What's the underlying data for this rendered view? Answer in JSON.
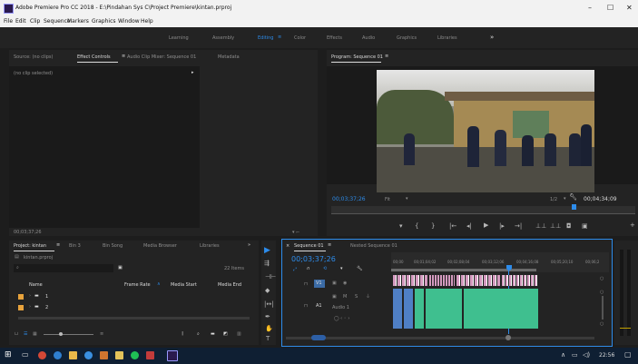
{
  "window": {
    "title": "Adobe Premiere Pro CC 2018 - E:\\Pindahan Sys C\\Project Premiere\\kintan.prproj",
    "controls": [
      "–",
      "☐",
      "✕"
    ]
  },
  "menu": [
    "File",
    "Edit",
    "Clip",
    "Sequence",
    "Markers",
    "Graphics",
    "Window",
    "Help"
  ],
  "workspaces": {
    "items": [
      "Learning",
      "Assembly",
      "Editing",
      "Color",
      "Effects",
      "Audio",
      "Graphics",
      "Libraries"
    ],
    "active": "Editing",
    "more": "»"
  },
  "source_panel": {
    "tabs": [
      "Source: (no clips)",
      "Effect Controls",
      "Audio Clip Mixer: Sequence 01",
      "Metadata"
    ],
    "active_tab": "Effect Controls",
    "no_clip": "(no clip selected)",
    "timecode": "00;03;37;26"
  },
  "program_monitor": {
    "tab": "Program: Sequence 01",
    "timecode_left": "00;03;37;26",
    "fit": "Fit",
    "quality": "1/2",
    "timecode_right": "00;04;34;09"
  },
  "project_panel": {
    "tabs": [
      "Project: kintan",
      "Bin 3",
      "Bin Song",
      "Media Browser",
      "Libraries"
    ],
    "active_tab": "Project: kintan",
    "project_name": "kintan.prproj",
    "item_count": "22 Items",
    "columns": [
      "Name",
      "Frame Rate",
      "Media Start",
      "Media End"
    ],
    "rows": [
      {
        "name": "1",
        "color": "#e8a33c"
      },
      {
        "name": "2",
        "color": "#e8a33c"
      }
    ]
  },
  "timeline": {
    "tabs": [
      "Sequence 01",
      "Nested Sequence 01"
    ],
    "active_tab": "Sequence 01",
    "timecode": "00;03;37;26",
    "ruler_labels": [
      "00;00",
      "00;01;04;02",
      "00;02;08;04",
      "00;03;12;06",
      "00;04;16;08",
      "00;05;20;10",
      "00;06;2"
    ],
    "audio_label": "Audio 1",
    "video_track": "V1",
    "audio_track": "A1"
  },
  "taskbar": {
    "time": "22:56",
    "icons": [
      "windows-start",
      "task-view",
      "chrome",
      "edge",
      "premiere",
      "explorer",
      "whatsapp",
      "media"
    ]
  },
  "colors": {
    "accent": "#2d8ceb",
    "clip_video": "#d49abf",
    "clip_audio": "#3fbf8f",
    "premiere": "#2a1a4d"
  }
}
